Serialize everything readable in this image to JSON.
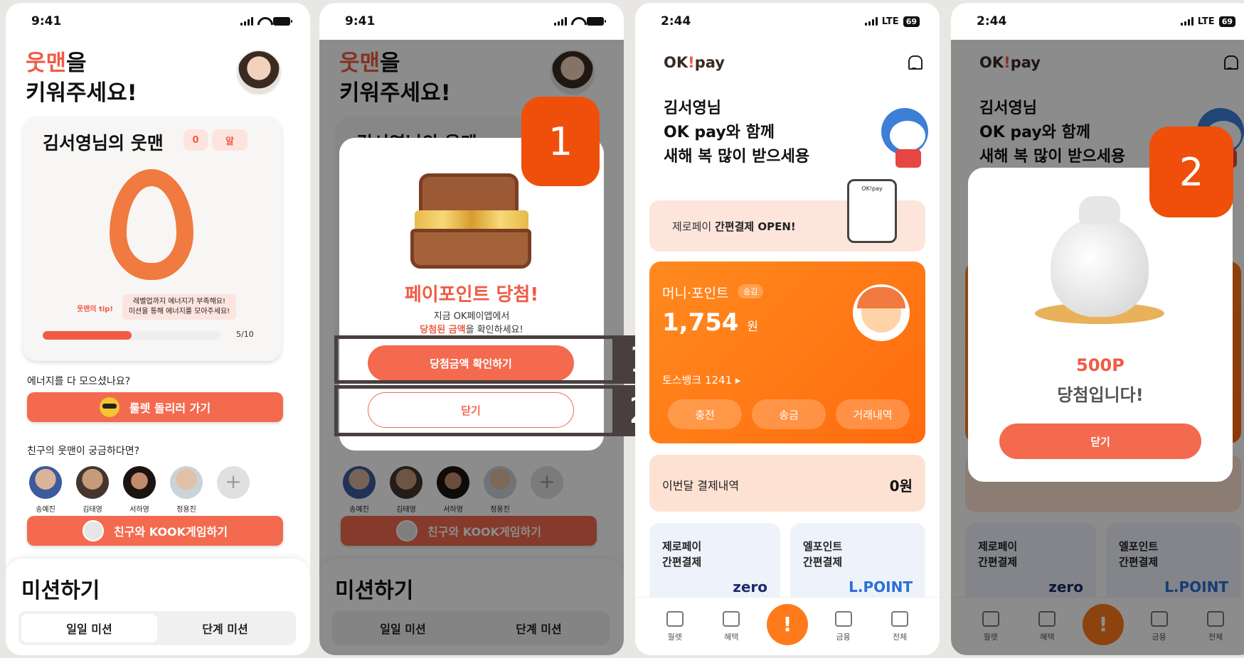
{
  "colors": {
    "accent": "#f05b45",
    "step_orange": "#ef4f0b",
    "step_dark": "#4a3f3f",
    "okpay_orange": "#ff7a1a"
  },
  "screen1": {
    "status": {
      "time": "9:41"
    },
    "title_highlight": "웃맨",
    "title_rest_line1": "을",
    "title_line2": "키워주세요!",
    "card_title": "김서영님의 웃맨",
    "pill_count": "0",
    "pill_egg": "알",
    "tip_label": "웃맨의 tip!",
    "tip_line1": "레벨업까지 에너지가 부족해요!",
    "tip_line2": "미션을 통해 에너지를 모아주세요!",
    "progress_text": "5/10",
    "progress_value": 0.5,
    "energy_question": "에너지를 다 모으셨나요?",
    "roulette_button": "룰렛 돌리러 가기",
    "friends_question": "친구의 웃맨이 궁금하다면?",
    "friends": [
      "송예진",
      "김태영",
      "서하영",
      "정용진"
    ],
    "kook_button": "친구와 KOOK게임하기",
    "mission_title": "미션하기",
    "mission_tabs": [
      "일일 미션",
      "단계 미션"
    ]
  },
  "screen2": {
    "status": {
      "time": "9:41"
    },
    "modal_title_a": "페이포인트",
    "modal_title_b": " 당첨!",
    "modal_sub1": "지금 OK페이앱에서",
    "modal_sub2_b": "당첨된 금액",
    "modal_sub2_rest": "을 확인하세요!",
    "confirm_button": "당첨금액 확인하기",
    "close_button": "닫기",
    "step_big": "1",
    "step_tab1": "1",
    "step_tab2": "2"
  },
  "screen3": {
    "status": {
      "time": "2:44",
      "network": "LTE",
      "battery": "69"
    },
    "logo_a": "OK",
    "logo_t": "!",
    "logo_b": "pay",
    "greet1": "김서영님",
    "greet2": "OK pay와 함께",
    "greet3": "새해 복 많이 받으세용",
    "banner_prefix": "제로페이 ",
    "banner_bold": "간편결제 OPEN!",
    "banner_phone_label": "OK!pay",
    "money_label": "머니·포인트",
    "money_badge": "송김",
    "money_amount": "1,754",
    "money_unit": "원",
    "account": "토스뱅크 1241 ▸",
    "money_buttons": [
      "충전",
      "송금",
      "거래내역"
    ],
    "monthly_label": "이번달 결제내역",
    "monthly_value": "0원",
    "tile1_line1": "제로페이",
    "tile1_line2": "간편결제",
    "tile1_logo": "zero",
    "tile2_line1": "엘포인트",
    "tile2_line2": "간편결제",
    "tile2_logo": "L.POINT",
    "tabs": [
      "월렛",
      "혜택",
      "금융",
      "전체"
    ],
    "tab_center": "!"
  },
  "screen4": {
    "status": {
      "time": "2:44",
      "network": "LTE",
      "battery": "69"
    },
    "logo_a": "OK",
    "logo_t": "!",
    "logo_b": "pay",
    "greet1": "김서영님",
    "greet2": "OK pay와 함께",
    "greet3": "새해 복 많이 받으세용",
    "prize": "500P",
    "prize_sub": "당첨입니다!",
    "close_button": "닫기",
    "step_big": "2",
    "tile1_line1": "제로페이",
    "tile1_line2": "간편결제",
    "tile1_logo": "zero",
    "tile2_line1": "엘포인트",
    "tile2_line2": "간편결제",
    "tile2_logo": "L.POINT",
    "tabs": [
      "월렛",
      "혜택",
      "금융",
      "전체"
    ],
    "tab_center": "!"
  }
}
